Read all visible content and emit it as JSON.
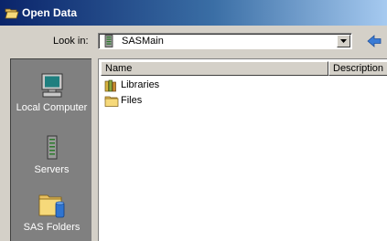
{
  "window": {
    "title": "Open Data"
  },
  "lookin": {
    "label": "Look in:",
    "value": "SASMain"
  },
  "places": [
    {
      "label": "Local Computer",
      "icon": "computer-icon"
    },
    {
      "label": "Servers",
      "icon": "server-icon"
    },
    {
      "label": "SAS Folders",
      "icon": "sas-folder-icon"
    }
  ],
  "filelist": {
    "columns": [
      "Name",
      "Description"
    ],
    "items": [
      {
        "label": "Libraries",
        "icon": "library-icon"
      },
      {
        "label": "Files",
        "icon": "folder-icon"
      }
    ]
  },
  "colors": {
    "title_start": "#0a246a",
    "title_end": "#a6caf0",
    "face": "#d4d0c8",
    "places_bg": "#808080",
    "back_arrow": "#3a7bd5"
  }
}
